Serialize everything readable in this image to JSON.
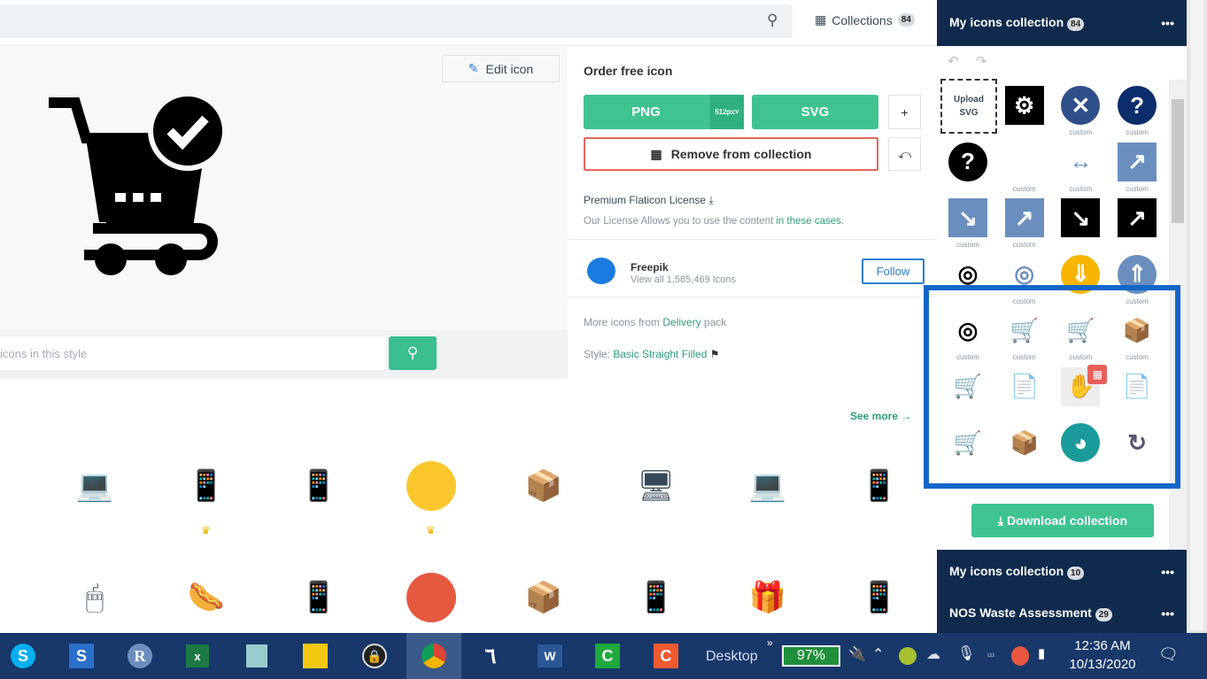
{
  "header": {
    "collections_label": "Collections",
    "collections_count": "84"
  },
  "preview": {
    "edit_label": "Edit icon",
    "style_search_placeholder": "icons in this style"
  },
  "order": {
    "title": "Order free icon",
    "png": "PNG",
    "png_size": "512px",
    "svg": "SVG",
    "plus": "+",
    "remove": "Remove from collection",
    "license_title": "Premium Flaticon License",
    "license_text": "Our License Allows you to use the content ",
    "license_link": "in these cases",
    "author": "Freepik",
    "author_sub": "View all 1,585,469 Icons",
    "follow": "Follow",
    "more_prefix": "More icons from ",
    "more_link": "Delivery",
    "more_suffix": " pack",
    "style_prefix": "Style: ",
    "style_link": "Basic Straight Filled"
  },
  "related": {
    "see_more": "See more"
  },
  "collection": {
    "title": "My icons collection",
    "count": "84",
    "upload": "Upload SVG",
    "custom": "custom",
    "download": "Download collection",
    "others": [
      {
        "title": "My icons collection",
        "count": "10"
      },
      {
        "title": "NOS Waste Assessment",
        "count": "29"
      }
    ]
  },
  "taskbar": {
    "desktop": "Desktop",
    "battery": "97%",
    "time": "12:36 AM",
    "date": "10/13/2020"
  },
  "colors": {
    "accent": "#3fc391",
    "navy": "#0f2a4d",
    "highlight": "#1466c8",
    "remove_border": "#e5675f"
  }
}
